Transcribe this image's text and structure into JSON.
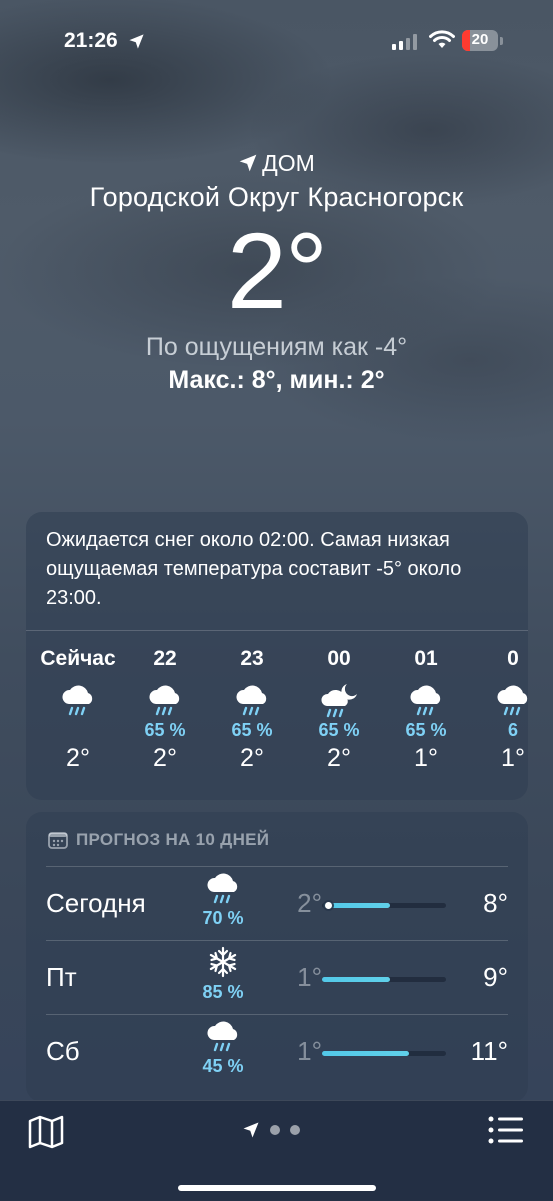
{
  "status_bar": {
    "time": "21:26",
    "battery_level": "20",
    "battery_color": "#ff3b30"
  },
  "location": {
    "label": "ДОМ",
    "city": "Городской Округ Красногорск"
  },
  "current": {
    "temperature": "2°",
    "feels_like": "По ощущениям как -4°",
    "max_min": "Макс.: 8°, мин.: 2°"
  },
  "summary": "Ожидается снег около 02:00. Самая низкая ощущаемая температура соста­вит -5° около 23:00.",
  "hourly": [
    {
      "label": "Сейчас",
      "icon": "rain-cloud-icon",
      "pop": "",
      "temp": "2°"
    },
    {
      "label": "22",
      "icon": "rain-cloud-icon",
      "pop": "65 %",
      "temp": "2°"
    },
    {
      "label": "23",
      "icon": "rain-cloud-icon",
      "pop": "65 %",
      "temp": "2°"
    },
    {
      "label": "00",
      "icon": "moon-cloud-rain-icon",
      "pop": "65 %",
      "temp": "2°"
    },
    {
      "label": "01",
      "icon": "rain-cloud-icon",
      "pop": "65 %",
      "temp": "1°"
    },
    {
      "label": "0",
      "icon": "rain-cloud-icon",
      "pop": "6",
      "temp": "1°"
    }
  ],
  "forecast": {
    "header": "ПРОГНОЗ НА 10 ДНЕЙ",
    "days": [
      {
        "day": "Сегодня",
        "icon": "rain-cloud-icon",
        "pop": "70 %",
        "low": "2°",
        "high": "8°",
        "range_start": 0.02,
        "range_end": 0.55,
        "current_marker": 0.05
      },
      {
        "day": "Пт",
        "icon": "snowflake-icon",
        "pop": "85 %",
        "low": "1°",
        "high": "9°",
        "range_start": 0.0,
        "range_end": 0.55
      },
      {
        "day": "Сб",
        "icon": "rain-cloud-icon",
        "pop": "45 %",
        "low": "1°",
        "high": "11°",
        "range_start": 0.0,
        "range_end": 0.7
      }
    ]
  }
}
